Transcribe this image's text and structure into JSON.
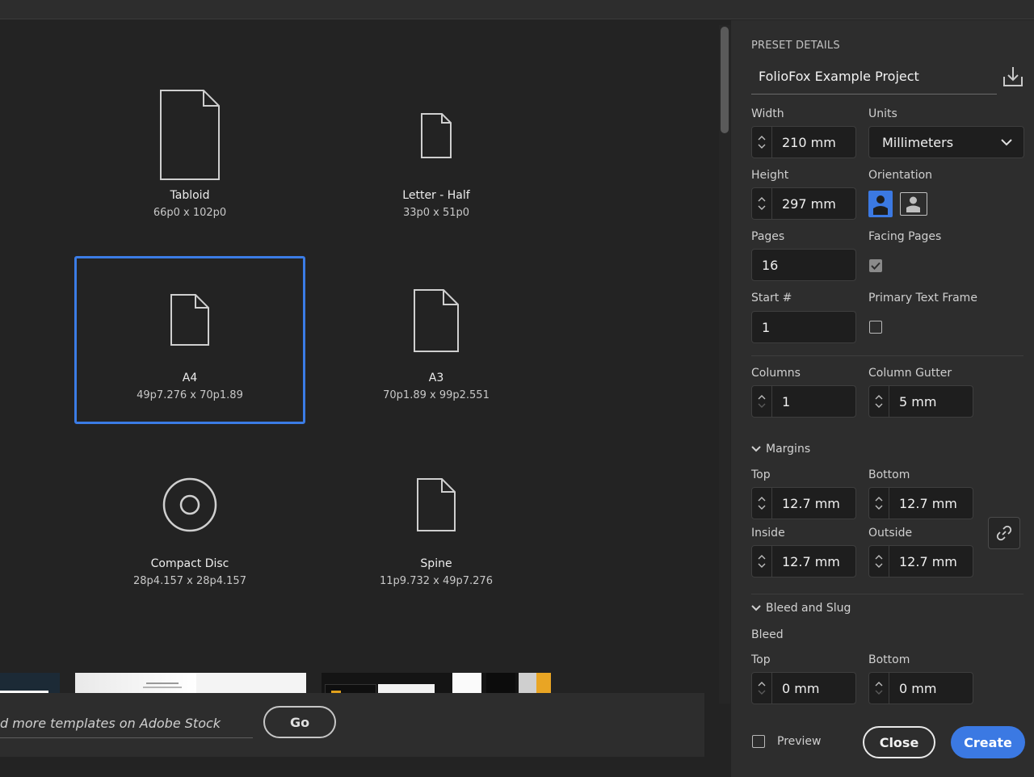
{
  "presets": [
    {
      "name": "Tabloid",
      "size": "66p0 x 102p0",
      "icon": "document-icon"
    },
    {
      "name": "Letter - Half",
      "size": "33p0 x 51p0",
      "icon": "document-icon"
    },
    {
      "name": "A4",
      "size": "49p7.276 x 70p1.89",
      "icon": "document-icon",
      "selected": true
    },
    {
      "name": "A3",
      "size": "70p1.89 x 99p2.551",
      "icon": "document-icon"
    },
    {
      "name": "Compact Disc",
      "size": "28p4.157 x 28p4.157",
      "icon": "disc-icon"
    },
    {
      "name": "Spine",
      "size": "11p9.732 x 49p7.276",
      "icon": "document-icon"
    }
  ],
  "stock": {
    "placeholder": "d more templates on Adobe Stock",
    "go_label": "Go"
  },
  "details": {
    "header": "PRESET DETAILS",
    "preset_name": "FolioFox Example Project",
    "width_label": "Width",
    "width_value": "210 mm",
    "units_label": "Units",
    "units_value": "Millimeters",
    "height_label": "Height",
    "height_value": "297 mm",
    "orientation_label": "Orientation",
    "pages_label": "Pages",
    "pages_value": "16",
    "facing_label": "Facing Pages",
    "start_label": "Start #",
    "start_value": "1",
    "primary_label": "Primary Text Frame",
    "columns_label": "Columns",
    "columns_value": "1",
    "gutter_label": "Column Gutter",
    "gutter_value": "5 mm",
    "margins": {
      "section": "Margins",
      "top_label": "Top",
      "top_value": "12.7 mm",
      "bottom_label": "Bottom",
      "bottom_value": "12.7 mm",
      "inside_label": "Inside",
      "inside_value": "12.7 mm",
      "outside_label": "Outside",
      "outside_value": "12.7 mm"
    },
    "bleed": {
      "section": "Bleed and Slug",
      "sub": "Bleed",
      "top_label": "Top",
      "top_value": "0 mm",
      "bottom_label": "Bottom",
      "bottom_value": "0 mm"
    }
  },
  "footer": {
    "preview_label": "Preview",
    "close_label": "Close",
    "create_label": "Create"
  },
  "colors": {
    "accent": "#3b79e3",
    "selection": "#3b7ce5"
  }
}
